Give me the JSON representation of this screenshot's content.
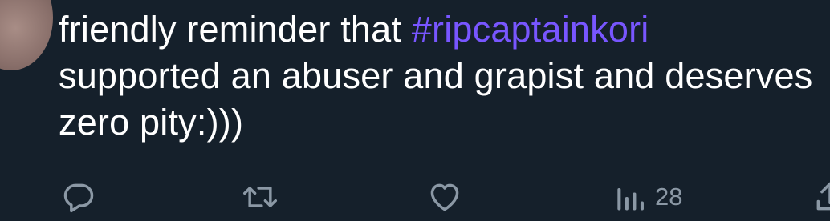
{
  "tweet": {
    "text_part1": "friendly reminder that ",
    "hashtag": "#ripcaptainkori",
    "text_part2": " supported an abuser and grapist and deserves zero pity:)))"
  },
  "actions": {
    "views_count": "28"
  },
  "colors": {
    "background": "#15202b",
    "text": "#ffffff",
    "hashtag": "#7856ff",
    "icon": "#8b98a5"
  },
  "icons": [
    "reply-icon",
    "retweet-icon",
    "like-icon",
    "views-icon",
    "share-icon"
  ]
}
